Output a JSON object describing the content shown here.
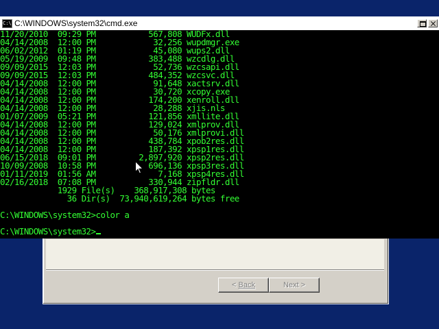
{
  "console": {
    "title": "C:\\WINDOWS\\system32\\cmd.exe",
    "text_color": "#33ff33",
    "background": "#000000",
    "listing": [
      {
        "date": "11/20/2010",
        "time": "09:29 PM",
        "size": "567,808",
        "name": "WUDFx.dll"
      },
      {
        "date": "04/14/2008",
        "time": "12:00 PM",
        "size": "32,256",
        "name": "wupdmgr.exe"
      },
      {
        "date": "06/02/2012",
        "time": "01:19 PM",
        "size": "45,080",
        "name": "wups2.dll"
      },
      {
        "date": "05/19/2009",
        "time": "09:48 PM",
        "size": "383,488",
        "name": "wzcdlg.dll"
      },
      {
        "date": "09/09/2015",
        "time": "12:03 PM",
        "size": "52,736",
        "name": "wzcsapi.dll"
      },
      {
        "date": "09/09/2015",
        "time": "12:03 PM",
        "size": "484,352",
        "name": "wzcsvc.dll"
      },
      {
        "date": "04/14/2008",
        "time": "12:00 PM",
        "size": "91,648",
        "name": "xactsrv.dll"
      },
      {
        "date": "04/14/2008",
        "time": "12:00 PM",
        "size": "30,720",
        "name": "xcopy.exe"
      },
      {
        "date": "04/14/2008",
        "time": "12:00 PM",
        "size": "174,200",
        "name": "xenroll.dll"
      },
      {
        "date": "04/14/2008",
        "time": "12:00 PM",
        "size": "28,288",
        "name": "xjis.nls"
      },
      {
        "date": "01/07/2009",
        "time": "05:21 PM",
        "size": "121,856",
        "name": "xmllite.dll"
      },
      {
        "date": "04/14/2008",
        "time": "12:00 PM",
        "size": "129,024",
        "name": "xmlprov.dll"
      },
      {
        "date": "04/14/2008",
        "time": "12:00 PM",
        "size": "50,176",
        "name": "xmlprovi.dll"
      },
      {
        "date": "04/14/2008",
        "time": "12:00 PM",
        "size": "438,784",
        "name": "xpob2res.dll"
      },
      {
        "date": "04/14/2008",
        "time": "12:00 PM",
        "size": "187,392",
        "name": "xpsp1res.dll"
      },
      {
        "date": "06/15/2018",
        "time": "09:01 PM",
        "size": "2,897,920",
        "name": "xpsp2res.dll"
      },
      {
        "date": "10/09/2008",
        "time": "10:58 PM",
        "size": "696,136",
        "name": "xpsp3res.dll"
      },
      {
        "date": "01/11/2019",
        "time": "01:56 AM",
        "size": "7,168",
        "name": "xpsp4res.dll"
      },
      {
        "date": "02/16/2018",
        "time": "07:08 PM",
        "size": "330,944",
        "name": "zipfldr.dll"
      }
    ],
    "summary": {
      "files_line": "            1929 File(s)    368,917,308 bytes",
      "dirs_line": "              36 Dir(s)  73,940,619,264 bytes free"
    },
    "command_prompt": "C:\\WINDOWS\\system32>",
    "command_entered": "color a",
    "current_prompt": "C:\\WINDOWS\\system32>"
  },
  "wizard": {
    "back_label": "Back",
    "back_accel": "<",
    "next_label": "Next >",
    "background": "#d4d0c8"
  },
  "icons": {
    "console_icon": "cmd-app-icon",
    "maximize": "maximize-icon",
    "close": "close-icon",
    "pointer": "mouse-pointer-icon"
  },
  "desktop_color": "#0a246a"
}
